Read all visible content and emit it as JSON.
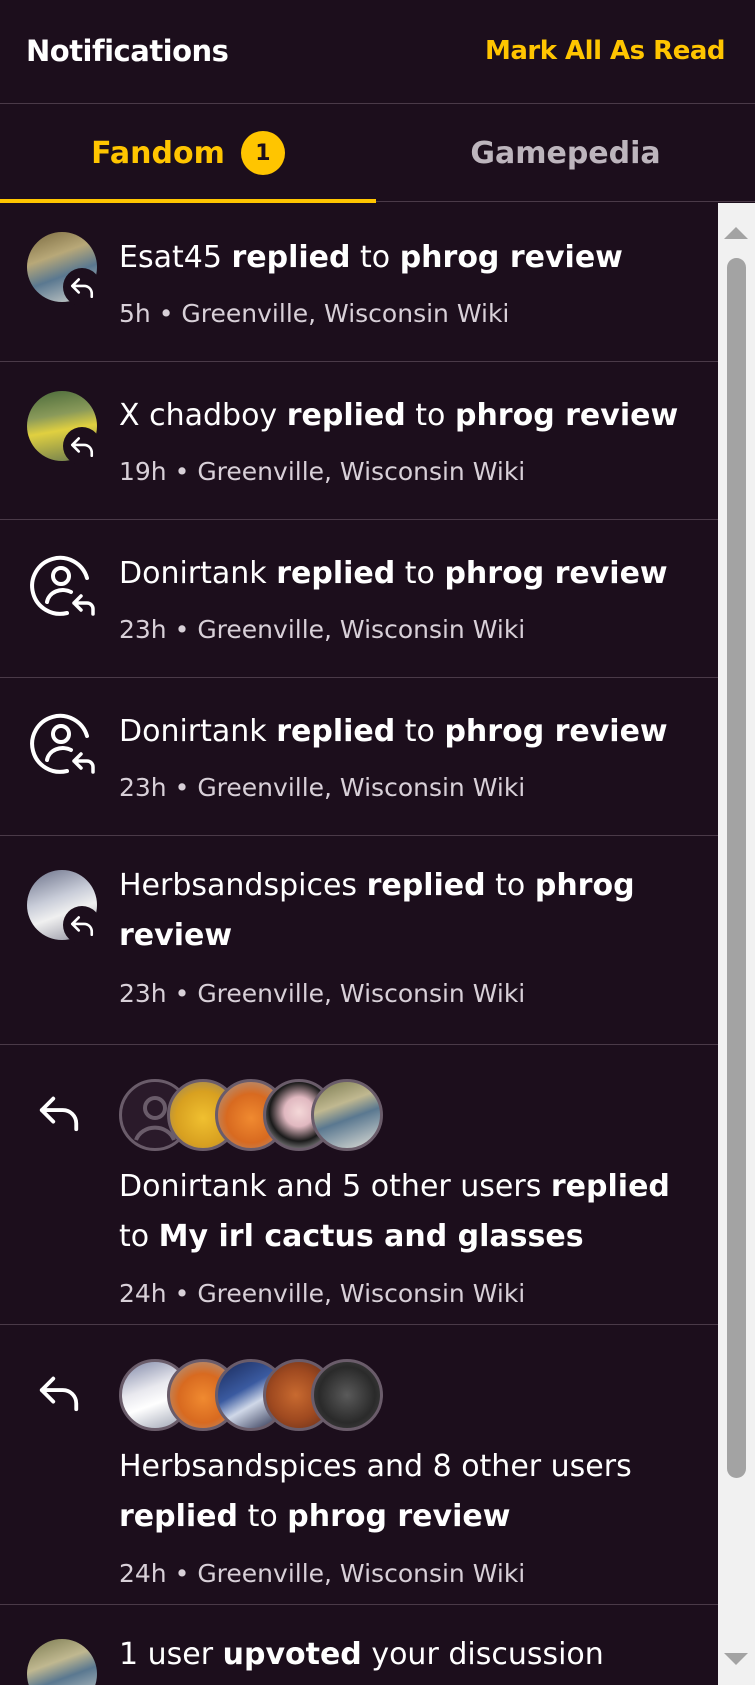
{
  "header": {
    "title": "Notifications",
    "mark_all": "Mark All As Read"
  },
  "tabs": [
    {
      "label": "Fandom",
      "badge": "1"
    },
    {
      "label": "Gamepedia"
    }
  ],
  "notifications": [
    {
      "user": "Esat45",
      "action": "replied",
      "to": "to",
      "target": "phrog review",
      "time": "5h",
      "wiki": "Greenville, Wisconsin Wiki"
    },
    {
      "user": "X chadboy",
      "action": "replied",
      "to": "to",
      "target": "phrog review",
      "time": "19h",
      "wiki": "Greenville, Wisconsin Wiki"
    },
    {
      "user": "Donirtank",
      "action": "replied",
      "to": "to",
      "target": "phrog review",
      "time": "23h",
      "wiki": "Greenville, Wisconsin Wiki"
    },
    {
      "user": "Donirtank",
      "action": "replied",
      "to": "to",
      "target": "phrog review",
      "time": "23h",
      "wiki": "Greenville, Wisconsin Wiki"
    },
    {
      "user": "Herbsandspices",
      "action": "replied",
      "to": "to",
      "target": "phrog",
      "target2": "review",
      "time": "23h",
      "wiki": "Greenville, Wisconsin Wiki"
    },
    {
      "user": "Donirtank and 5 other users",
      "action": "replied",
      "to": "to",
      "target": "My irl cactus and glasses",
      "time": "24h",
      "wiki": "Greenville, Wisconsin Wiki"
    },
    {
      "user": "Herbsandspices and 8 other users",
      "action": "replied",
      "to": "to",
      "target": "phrog review",
      "time": "24h",
      "wiki": "Greenville, Wisconsin Wiki"
    },
    {
      "user": "1 user",
      "action": "upvoted",
      "to": "your discussion"
    }
  ],
  "meta_sep": "•"
}
